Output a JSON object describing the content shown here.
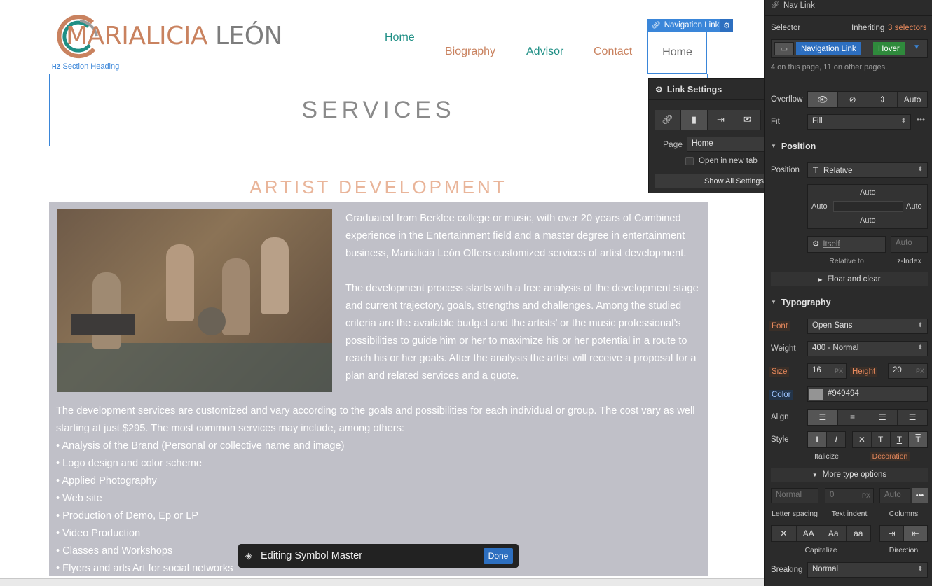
{
  "header": {
    "logo_text_part1": "MARIALICIA ",
    "logo_text_part2": "LEÓN",
    "section_heading_tag": "H2",
    "section_heading_label": "Section Heading"
  },
  "nav": {
    "home_top": "Home",
    "biography": "Biography",
    "advisor": "Advisor",
    "contact": "Contact",
    "home_selected": "Home",
    "selected_badge": "Navigation Link"
  },
  "services": {
    "title": "SERVICES"
  },
  "artist_dev": {
    "title": "ARTIST DEVELOPMENT",
    "para1": "Graduated from Berklee college or music, with over 20 years of Combined experience  in the Entertainment field and a master degree in entertainment business, Marialicia León Offers customized services of artist development.",
    "para2": "The development process starts with a free analysis of the development stage and current trajectory, goals, strengths and challenges.  Among the studied criteria are the available budget and the artists’ or the music professional’s possibilities to guide him or her to maximize his or her potential in a route to reach his or her goals. After the analysis the artist will receive a proposal for a plan and related services and a quote.",
    "para3": "The development services are customized and vary according to the goals and possibilities for each individual or group. The cost vary as well starting at just $295. The most common services may include, among others:",
    "items": [
      "Analysis of the Brand (Personal or collective name and image)",
      "Logo design and color scheme",
      "Applied Photography",
      "Web site",
      "Production of Demo, Ep or LP",
      "Video Production",
      "Classes and Workshops",
      "Flyers and arts Art for social networks"
    ]
  },
  "symbol_bar": {
    "label": "Editing Symbol Master",
    "done": "Done"
  },
  "link_settings": {
    "title": "Link Settings",
    "page_label": "Page",
    "page_value": "Home",
    "open_new_tab": "Open in new tab",
    "show_all": "Show All Settings"
  },
  "panel": {
    "header": "Nav Link",
    "selector_label": "Selector",
    "inheriting": "Inheriting",
    "inheriting_count": "3 selectors",
    "chip1": "Navigation Link",
    "chip2": "Hover",
    "selector_info": "4 on this page, 11 on other pages.",
    "overflow_label": "Overflow",
    "overflow_auto": "Auto",
    "fit_label": "Fit",
    "fit_value": "Fill",
    "position_section": "Position",
    "position_label": "Position",
    "position_value": "Relative",
    "pos_top": "Auto",
    "pos_left": "Auto",
    "pos_right": "Auto",
    "pos_bottom": "Auto",
    "relative_to_value": "Itself",
    "relative_to_label": "Relative to",
    "zindex_value": "Auto",
    "zindex_label": "z-Index",
    "float_clear": "Float and clear",
    "typography_section": "Typography",
    "font_label": "Font",
    "font_value": "Open Sans",
    "weight_label": "Weight",
    "weight_value": "400 - Normal",
    "size_label": "Size",
    "size_value": "16",
    "size_unit": "PX",
    "height_label": "Height",
    "height_value": "20",
    "height_unit": "PX",
    "color_label": "Color",
    "color_value": "#949494",
    "align_label": "Align",
    "style_label": "Style",
    "italicize_label": "Italicize",
    "decoration_label": "Decoration",
    "more_type": "More type options",
    "letter_spacing_value": "Normal",
    "letter_spacing_label": "Letter spacing",
    "text_indent_value": "0",
    "text_indent_unit": "PX",
    "text_indent_label": "Text indent",
    "columns_value": "Auto",
    "columns_label": "Columns",
    "capitalize_label": "Capitalize",
    "direction_label": "Direction",
    "breaking_label": "Breaking",
    "breaking_value": "Normal",
    "cap_options": [
      "✕",
      "AA",
      "Aa",
      "aa"
    ]
  },
  "colors": {
    "accent_blue": "#3a86d9",
    "brand_orange": "#c9825f",
    "brand_teal": "#1f8f85",
    "text_color_swatch": "#949494",
    "panel_bg": "#2b2b2b"
  }
}
